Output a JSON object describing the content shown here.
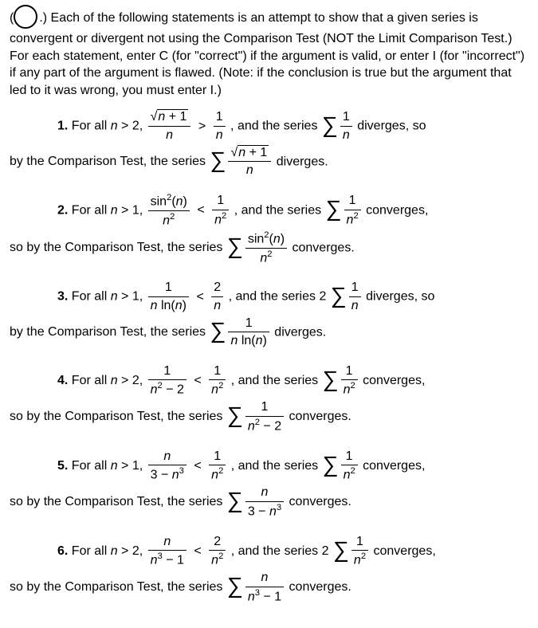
{
  "intro": {
    "prefix": "(",
    "dots": ".)",
    "text": " Each of the following statements is an attempt to show that a given series is convergent or divergent not using the Comparison Test (NOT the Limit Comparison Test.) For each statement, enter C (for \"correct\") if the argument is valid, or enter I (for \"incorrect\") if any part of the argument is flawed. (Note: if the conclusion is true but the argument that led to it was wrong, you must enter I.)"
  },
  "labels": {
    "forall": "For all",
    "and_series": "and the series",
    "by_ct": "by the Comparison Test, the series",
    "so_by_ct": "so by the Comparison Test, the series",
    "diverges": "diverges.",
    "converges": "converges.",
    "diverges_so": "diverges, so",
    "converges_comma": "converges,"
  },
  "items": [
    {
      "num": "1.",
      "cond": "n > 2,",
      "lhs_top": "sqrt(n+1)",
      "lhs_bot": "n",
      "cmp": ">",
      "rhs_top": "1",
      "rhs_bot": "n",
      "ref_coef": "",
      "ref_top": "1",
      "ref_bot": "n",
      "ref_out": "diverges_so",
      "conclusion_prefix": "by_ct",
      "concl_top": "sqrt(n+1)",
      "concl_bot": "n",
      "concl_out": "diverges"
    },
    {
      "num": "2.",
      "cond": "n > 1,",
      "lhs_top": "sin²(n)",
      "lhs_bot": "n²",
      "cmp": "<",
      "rhs_top": "1",
      "rhs_bot": "n²",
      "ref_coef": "",
      "ref_top": "1",
      "ref_bot": "n²",
      "ref_out": "converges_comma",
      "conclusion_prefix": "so_by_ct",
      "concl_top": "sin²(n)",
      "concl_bot": "n²",
      "concl_out": "converges"
    },
    {
      "num": "3.",
      "cond": "n > 1,",
      "lhs_top": "1",
      "lhs_bot": "n ln(n)",
      "cmp": "<",
      "rhs_top": "2",
      "rhs_bot": "n",
      "ref_coef": "2",
      "ref_top": "1",
      "ref_bot": "n",
      "ref_out": "diverges_so",
      "conclusion_prefix": "by_ct",
      "concl_top": "1",
      "concl_bot": "n ln(n)",
      "concl_out": "diverges"
    },
    {
      "num": "4.",
      "cond": "n > 2,",
      "lhs_top": "1",
      "lhs_bot": "n² − 2",
      "cmp": "<",
      "rhs_top": "1",
      "rhs_bot": "n²",
      "ref_coef": "",
      "ref_top": "1",
      "ref_bot": "n²",
      "ref_out": "converges_comma",
      "conclusion_prefix": "so_by_ct",
      "concl_top": "1",
      "concl_bot": "n² − 2",
      "concl_out": "converges"
    },
    {
      "num": "5.",
      "cond": "n > 1,",
      "lhs_top": "n",
      "lhs_bot": "3 − n³",
      "cmp": "<",
      "rhs_top": "1",
      "rhs_bot": "n²",
      "ref_coef": "",
      "ref_top": "1",
      "ref_bot": "n²",
      "ref_out": "converges_comma",
      "conclusion_prefix": "so_by_ct",
      "concl_top": "n",
      "concl_bot": "3 − n³",
      "concl_out": "converges"
    },
    {
      "num": "6.",
      "cond": "n > 2,",
      "lhs_top": "n",
      "lhs_bot": "n³ − 1",
      "cmp": "<",
      "rhs_top": "2",
      "rhs_bot": "n²",
      "ref_coef": "2",
      "ref_top": "1",
      "ref_bot": "n²",
      "ref_out": "converges_comma",
      "conclusion_prefix": "so_by_ct",
      "concl_top": "n",
      "concl_bot": "n³ − 1",
      "concl_out": "converges"
    }
  ]
}
